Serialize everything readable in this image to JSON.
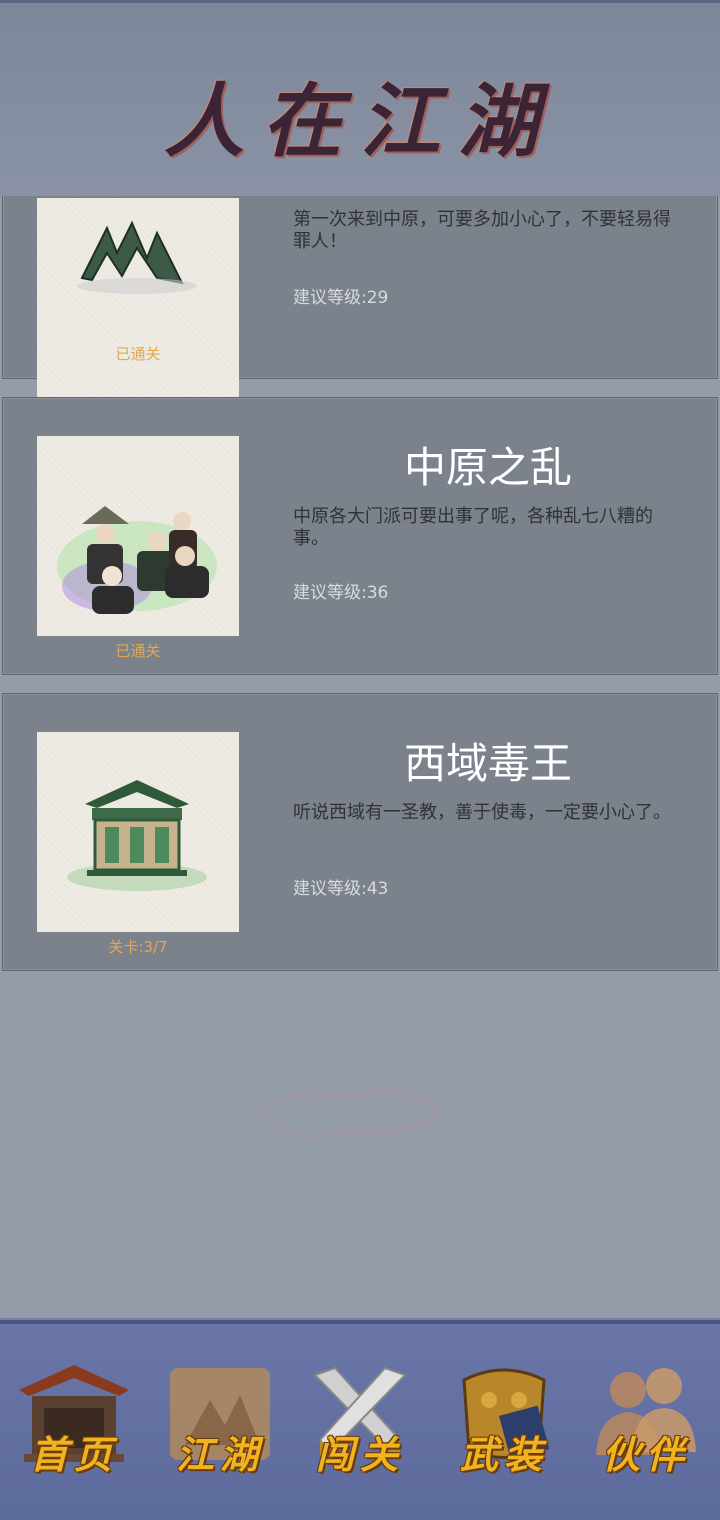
{
  "app": {
    "title": "人在江湖"
  },
  "levels": [
    {
      "title": "",
      "description": "第一次来到中原，可要多加小心了，不要轻易得罪人！",
      "level": "建议等级:29",
      "status": "已通关",
      "icon": "mountain-icon"
    },
    {
      "title": "中原之乱",
      "description": "中原各大门派可要出事了呢，各种乱七八糟的事。",
      "level": "建议等级:36",
      "status": "已通关",
      "icon": "martial-artists-icon"
    },
    {
      "title": "西域毒王",
      "description": "听说西域有一圣教，善于使毒，一定要小心了。",
      "level": "建议等级:43",
      "status": "关卡:3/7",
      "icon": "pavilion-icon"
    }
  ],
  "nav": [
    {
      "label": "首页",
      "icon": "house-icon"
    },
    {
      "label": "江湖",
      "icon": "scroll-map-icon"
    },
    {
      "label": "闯关",
      "icon": "crossed-swords-icon"
    },
    {
      "label": "武装",
      "icon": "armor-icon"
    },
    {
      "label": "伙伴",
      "icon": "partners-icon"
    }
  ],
  "colors": {
    "status": "#e4a84e",
    "nav_label": "#f2b320",
    "card_bg": "#7b828c",
    "nav_bg": "#6a76a8"
  }
}
